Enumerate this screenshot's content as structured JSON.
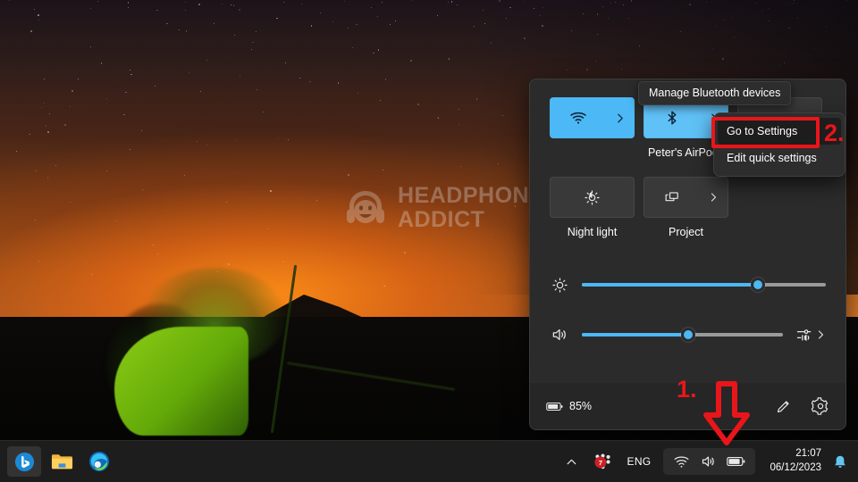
{
  "desktop": {
    "watermark": {
      "line1": "HEADPHONES",
      "line2": "ADDICT",
      "logo_icon": "headphones-smiley-logo"
    }
  },
  "quick_settings": {
    "tooltip": {
      "text": "Manage Bluetooth devices",
      "icon": "tooltip"
    },
    "tiles": [
      {
        "name": "wifi",
        "icon": "wifi-icon",
        "chevron_icon": "chevron-right-icon",
        "label": "",
        "label_blurred": true,
        "active": true,
        "has_chevron": true
      },
      {
        "name": "bluetooth",
        "icon": "bluetooth-icon",
        "chevron_icon": "chevron-right-icon",
        "label": "Peter's AirPods",
        "label_blurred": false,
        "active": true,
        "has_chevron": true
      },
      {
        "name": "night-light",
        "icon": "night-light-icon",
        "chevron_icon": "",
        "label": "Night light",
        "label_blurred": false,
        "active": false,
        "has_chevron": false
      },
      {
        "name": "project",
        "icon": "project-icon",
        "chevron_icon": "chevron-right-icon",
        "label": "Project",
        "label_blurred": false,
        "active": false,
        "has_chevron": true
      }
    ],
    "brightness_slider": {
      "icon": "brightness-icon",
      "value": 72,
      "accent": "#4cb8f5"
    },
    "volume_slider": {
      "icon": "volume-icon",
      "value": 53,
      "accent": "#4cb8f5",
      "aux_icon": "audio-output-selector-icon",
      "aux_chevron_icon": "chevron-right-icon"
    },
    "footer": {
      "battery_icon": "battery-icon",
      "battery_label": "85%",
      "edit_icon": "pencil-icon",
      "settings_icon": "gear-icon"
    }
  },
  "context_menu": {
    "items": [
      {
        "label": "Go to Settings",
        "selected": true
      },
      {
        "label": "Edit quick settings",
        "selected": false
      }
    ]
  },
  "annotations": {
    "color": "#e8161a",
    "step1_label": "1.",
    "step2_label": "2.",
    "arrow_icon": "down-arrow-annotation",
    "highlight_box": "go-to-settings-highlight"
  },
  "taskbar": {
    "apps": [
      {
        "name": "bing-copilot",
        "icon": "bing-copilot-icon",
        "running": true
      },
      {
        "name": "file-explorer",
        "icon": "folder-icon",
        "running": false
      },
      {
        "name": "edge-browser",
        "icon": "edge-icon",
        "running": false
      }
    ],
    "chevron_icon": "chevron-up-icon",
    "security_icon": "security-notification-icon",
    "security_badge": "7",
    "language": "ENG",
    "tray": [
      {
        "name": "wifi",
        "icon": "wifi-icon"
      },
      {
        "name": "volume",
        "icon": "volume-icon"
      },
      {
        "name": "battery",
        "icon": "battery-icon"
      }
    ],
    "clock": {
      "time": "21:07",
      "date": "06/12/2023"
    },
    "notification_icon": "bell-icon"
  }
}
